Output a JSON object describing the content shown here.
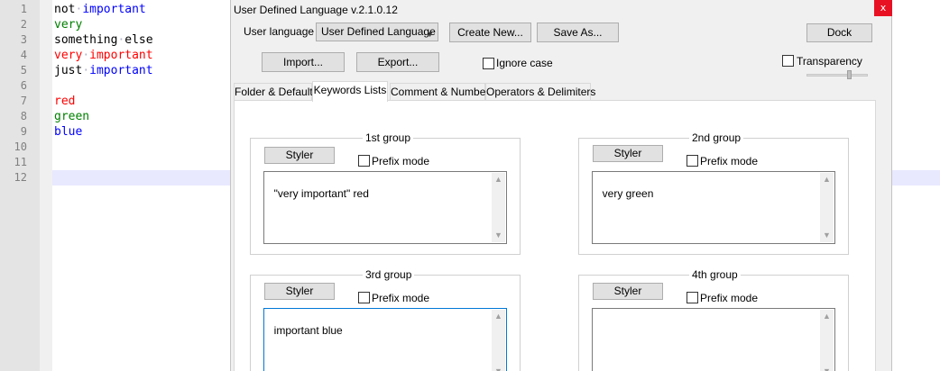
{
  "editor": {
    "line_numbers": [
      "1",
      "2",
      "3",
      "4",
      "5",
      "6",
      "7",
      "8",
      "9",
      "10",
      "11",
      "12"
    ],
    "lines": [
      [
        {
          "t": "not",
          "c": "black"
        },
        {
          "t": "·",
          "c": "ws"
        },
        {
          "t": "important",
          "c": "blue"
        }
      ],
      [
        {
          "t": "very",
          "c": "green"
        }
      ],
      [
        {
          "t": "something",
          "c": "black"
        },
        {
          "t": "·",
          "c": "ws"
        },
        {
          "t": "else",
          "c": "black"
        }
      ],
      [
        {
          "t": "very",
          "c": "red"
        },
        {
          "t": "·",
          "c": "ws"
        },
        {
          "t": "important",
          "c": "red"
        }
      ],
      [
        {
          "t": "just",
          "c": "black"
        },
        {
          "t": "·",
          "c": "ws"
        },
        {
          "t": "important",
          "c": "blue"
        }
      ],
      [],
      [
        {
          "t": "red",
          "c": "red"
        }
      ],
      [
        {
          "t": "green",
          "c": "green"
        }
      ],
      [
        {
          "t": "blue",
          "c": "blue"
        }
      ],
      [],
      [],
      []
    ]
  },
  "dialog": {
    "title": "User Defined Language v.2.1.0.12",
    "close_glyph": "x",
    "user_language_label": "User language :",
    "user_language_value": "User Defined Language",
    "create_new": "Create New...",
    "save_as": "Save As...",
    "dock": "Dock",
    "import": "Import...",
    "export": "Export...",
    "ignore_case": "Ignore case",
    "transparency": "Transparency",
    "tabs": [
      "Folder & Default",
      "Keywords Lists",
      "Comment & Number",
      "Operators & Delimiters"
    ],
    "active_tab": "Keywords Lists",
    "groups": [
      {
        "title": "1st group",
        "styler": "Styler",
        "prefix_mode": "Prefix mode",
        "keywords": "\"very important\" red"
      },
      {
        "title": "2nd group",
        "styler": "Styler",
        "prefix_mode": "Prefix mode",
        "keywords": "very green"
      },
      {
        "title": "3rd group",
        "styler": "Styler",
        "prefix_mode": "Prefix mode",
        "keywords": "important blue"
      },
      {
        "title": "4th group",
        "styler": "Styler",
        "prefix_mode": "Prefix mode",
        "keywords": ""
      }
    ]
  },
  "colors": {
    "keyword_red": "#ff0000",
    "keyword_green": "#008000",
    "keyword_blue": "#0000ff",
    "close_button": "#e81123",
    "focus_border": "#0078d7"
  },
  "icons": {
    "close": "close-icon",
    "dropdown": "chevron-down-icon",
    "scroll_up": "scroll-up-icon",
    "scroll_down": "scroll-down-icon"
  }
}
